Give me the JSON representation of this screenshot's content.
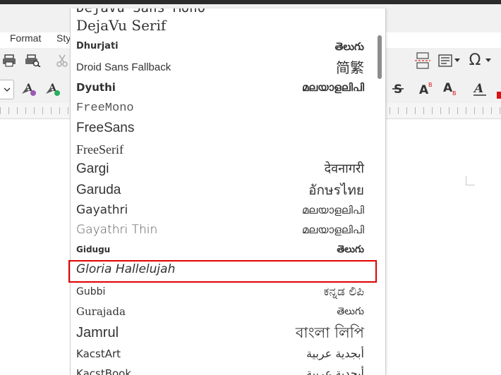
{
  "menubar": {
    "items": [
      "Format",
      "Sty"
    ]
  },
  "font_list": {
    "items": [
      {
        "name": "DejaVu Sans Mono",
        "sample": "",
        "font": "\"DejaVu Sans Mono\", monospace",
        "size": "19px",
        "weight": "normal",
        "style": "normal",
        "sampleFont": "\"DejaVu Sans\", sans-serif",
        "sampleSize": "16px"
      },
      {
        "name": "DejaVu Serif",
        "sample": "",
        "font": "\"DejaVu Serif\", serif",
        "size": "20px",
        "weight": "normal",
        "style": "normal",
        "sampleFont": "\"DejaVu Sans\", sans-serif",
        "sampleSize": "16px"
      },
      {
        "name": "Dhurjati",
        "sample": "తెలుగు",
        "font": "\"DejaVu Sans\", sans-serif",
        "size": "13px",
        "weight": "bold",
        "style": "normal",
        "sampleFont": "\"DejaVu Sans\", sans-serif",
        "sampleSize": "15px"
      },
      {
        "name": "Droid Sans Fallback",
        "sample": "简繁",
        "font": "\"Liberation Sans\", sans-serif",
        "size": "15px",
        "weight": "normal",
        "style": "normal",
        "sampleFont": "\"DejaVu Sans\", sans-serif",
        "sampleSize": "20px"
      },
      {
        "name": "Dyuthi",
        "sample": "മലയാളലിപി",
        "font": "\"DejaVu Sans\", sans-serif",
        "size": "15px",
        "weight": "bold",
        "style": "normal",
        "sampleFont": "\"DejaVu Sans\", sans-serif",
        "sampleSize": "15px"
      },
      {
        "name": "FreeMono",
        "sample": "",
        "font": "\"Liberation Mono\", monospace",
        "size": "17px",
        "weight": "normal",
        "style": "normal",
        "sampleFont": "\"DejaVu Sans\", sans-serif",
        "sampleSize": "16px"
      },
      {
        "name": "FreeSans",
        "sample": "",
        "font": "\"Liberation Sans\", sans-serif",
        "size": "19px",
        "weight": "normal",
        "style": "normal",
        "sampleFont": "\"DejaVu Sans\", sans-serif",
        "sampleSize": "16px"
      },
      {
        "name": "FreeSerif",
        "sample": "",
        "font": "\"Liberation Serif\", serif",
        "size": "18px",
        "weight": "normal",
        "style": "normal",
        "sampleFont": "\"DejaVu Sans\", sans-serif",
        "sampleSize": "16px"
      },
      {
        "name": "Gargi",
        "sample": "देवनागरी",
        "font": "\"Liberation Sans\", sans-serif",
        "size": "19px",
        "weight": "normal",
        "style": "normal",
        "sampleFont": "\"DejaVu Sans\", sans-serif",
        "sampleSize": "18px"
      },
      {
        "name": "Garuda",
        "sample": "อักษรไทย",
        "font": "\"Liberation Sans\", sans-serif",
        "size": "19px",
        "weight": "normal",
        "style": "normal",
        "sampleFont": "\"DejaVu Sans\", sans-serif",
        "sampleSize": "19px"
      },
      {
        "name": "Gayathri",
        "sample": "മലയാളലിപി",
        "font": "\"DejaVu Sans\", sans-serif",
        "size": "17px",
        "weight": "normal",
        "style": "normal",
        "sampleFont": "\"DejaVu Sans\", sans-serif",
        "sampleSize": "15px"
      },
      {
        "name": "Gayathri Thin",
        "sample": "മലയാളലിപി",
        "font": "\"DejaVu Sans\", sans-serif",
        "size": "17px",
        "weight": "200",
        "style": "normal",
        "sampleFont": "\"DejaVu Sans\", sans-serif",
        "sampleSize": "15px"
      },
      {
        "name": "Gidugu",
        "sample": "తెలుగు",
        "font": "\"DejaVu Sans\", sans-serif",
        "size": "12px",
        "weight": "bold",
        "style": "normal",
        "sampleFont": "\"DejaVu Sans\", sans-serif",
        "sampleSize": "14px"
      },
      {
        "name": "Gloria Hallelujah",
        "sample": "",
        "font": "\"DejaVu Sans\", sans-serif",
        "size": "17px",
        "weight": "normal",
        "style": "italic",
        "sampleFont": "\"DejaVu Sans\", sans-serif",
        "sampleSize": "16px"
      },
      {
        "name": "Gubbi",
        "sample": "ಕನ್ನಡ ಲಿಪಿ",
        "font": "\"DejaVu Sans\", sans-serif",
        "size": "14px",
        "weight": "normal",
        "style": "normal",
        "sampleFont": "\"DejaVu Sans\", sans-serif",
        "sampleSize": "17px"
      },
      {
        "name": "Gurajada",
        "sample": "తెలుగు",
        "font": "\"DejaVu Serif\", serif",
        "size": "15px",
        "weight": "normal",
        "style": "normal",
        "sampleFont": "\"DejaVu Sans\", sans-serif",
        "sampleSize": "14px"
      },
      {
        "name": "Jamrul",
        "sample": "বাংলা লিপি",
        "font": "\"Liberation Sans\", sans-serif",
        "size": "20px",
        "weight": "normal",
        "style": "normal",
        "sampleFont": "\"DejaVu Sans\", sans-serif",
        "sampleSize": "21px"
      },
      {
        "name": "KacstArt",
        "sample": "أبجدية عربية",
        "font": "\"DejaVu Sans\", sans-serif",
        "size": "15px",
        "weight": "normal",
        "style": "normal",
        "sampleFont": "\"DejaVu Sans\", sans-serif",
        "sampleSize": "16px"
      },
      {
        "name": "KacstBook",
        "sample": "أبجدية عربية",
        "font": "\"DejaVu Sans\", sans-serif",
        "size": "15px",
        "weight": "normal",
        "style": "normal",
        "sampleFont": "\"DejaVu Sans\", sans-serif",
        "sampleSize": "16px"
      }
    ],
    "selected": "Gloria Hallelujah"
  },
  "toolbar": {
    "special_char_symbol": "Ω"
  },
  "colors": {
    "selection_border": "#e00000",
    "accent_red": "#e74c3c"
  }
}
